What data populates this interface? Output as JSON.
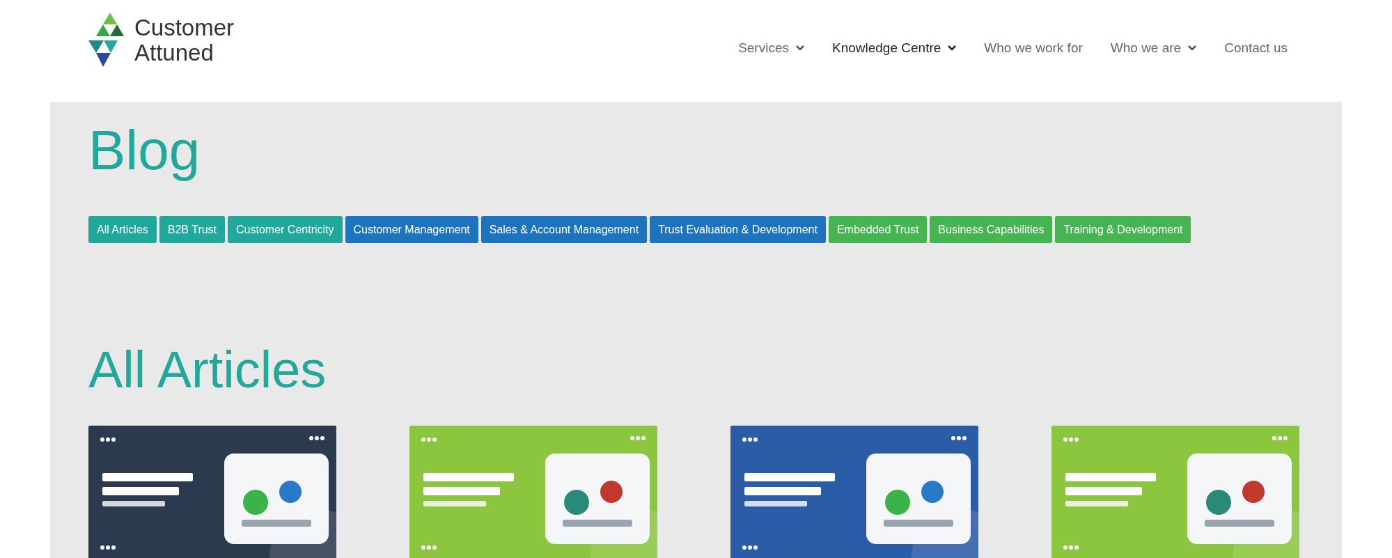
{
  "logo": {
    "lines": [
      "Customer",
      "Attuned"
    ]
  },
  "nav": [
    {
      "label": "Services",
      "dropdown": true,
      "selected": false
    },
    {
      "label": "Knowledge Centre",
      "dropdown": true,
      "selected": true
    },
    {
      "label": "Who we work for",
      "dropdown": false,
      "selected": false
    },
    {
      "label": "Who we are",
      "dropdown": true,
      "selected": false
    },
    {
      "label": "Contact us",
      "dropdown": false,
      "selected": false
    }
  ],
  "title": "Blog",
  "tags": [
    {
      "label": "All Articles",
      "color": "#20a99b"
    },
    {
      "label": "B2B Trust",
      "color": "#20a99b"
    },
    {
      "label": "Customer Centricity",
      "color": "#20a99b"
    },
    {
      "label": "Customer Management",
      "color": "#1e73be"
    },
    {
      "label": "Sales & Account Management",
      "color": "#1e73be"
    },
    {
      "label": "Trust Evaluation & Development",
      "color": "#1e73be"
    },
    {
      "label": "Embedded Trust",
      "color": "#46b450"
    },
    {
      "label": "Business Capabilities",
      "color": "#46b450"
    },
    {
      "label": "Training & Development",
      "color": "#46b450"
    }
  ],
  "section_title": "All Articles"
}
